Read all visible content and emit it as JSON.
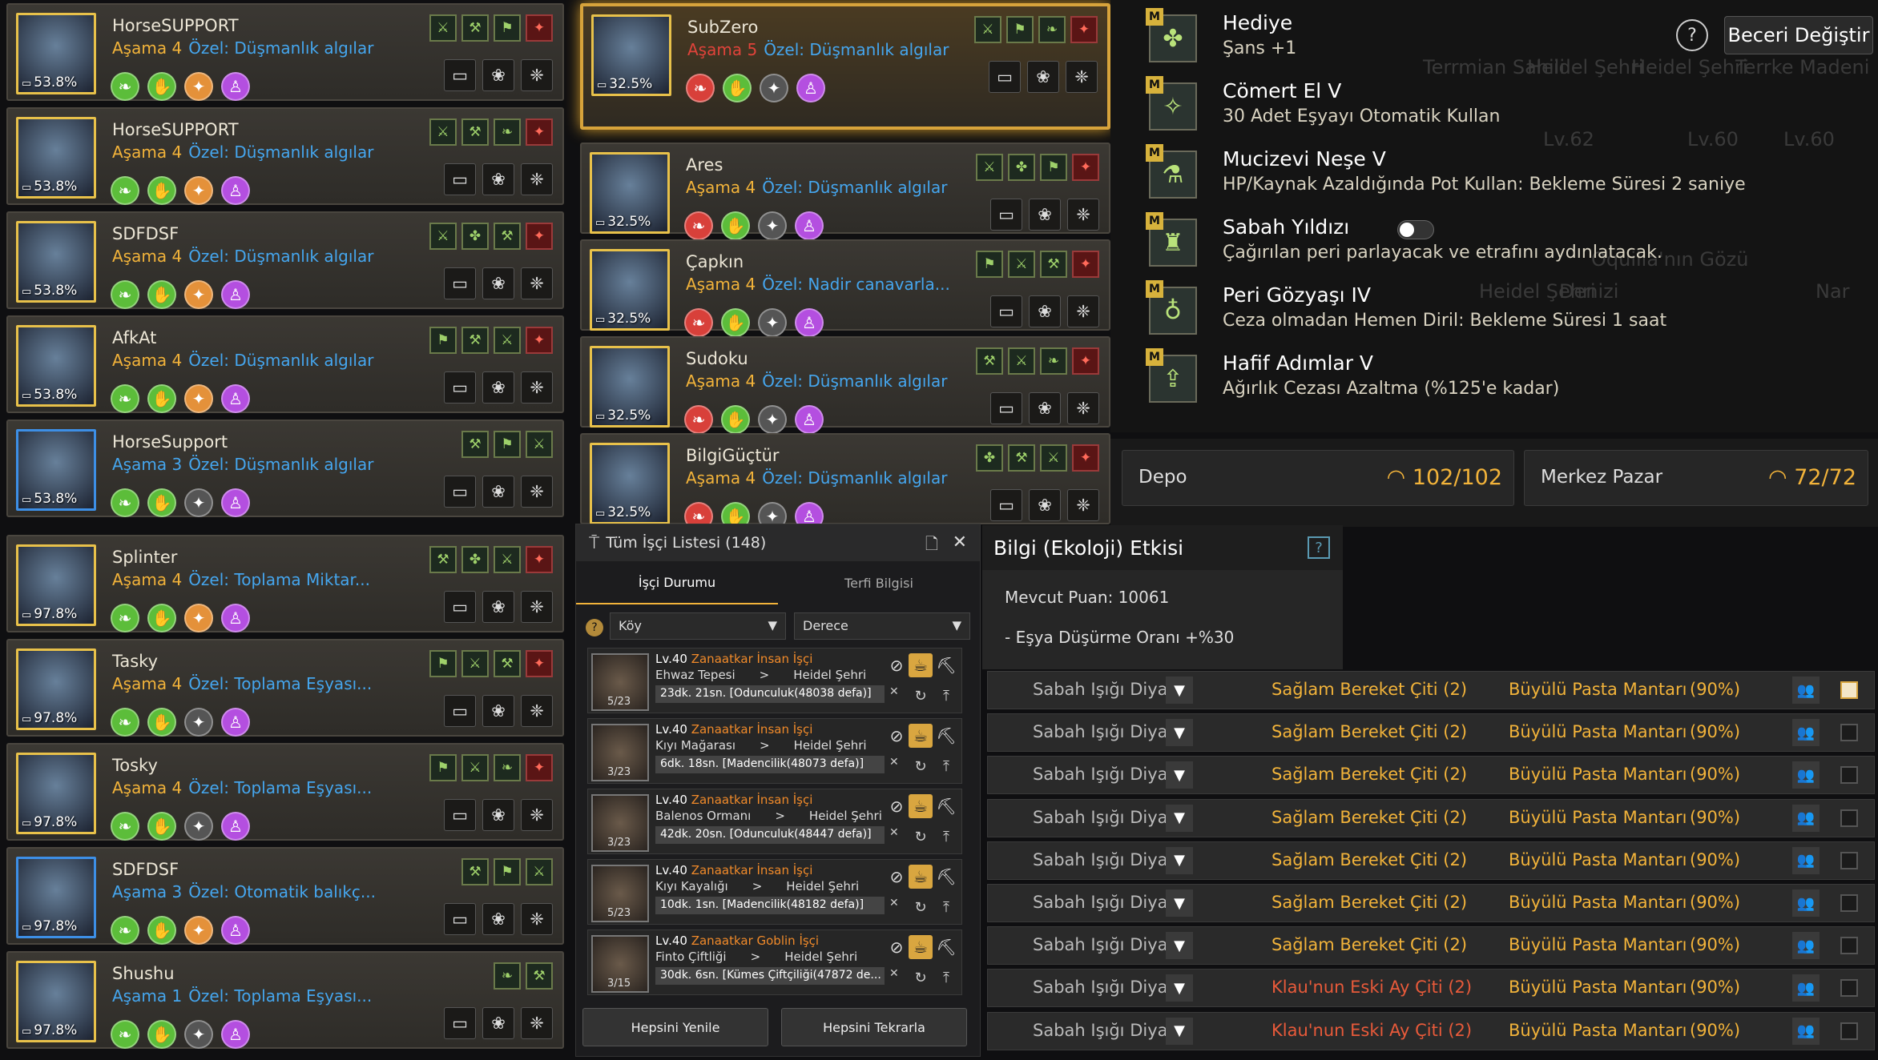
{
  "left_pets": [
    {
      "name": "HorseSUPPORT",
      "stage": "Aşama 4",
      "special": "Özel: Düşmanlık algılar",
      "pct": "53.8%",
      "traits": [
        "⚔",
        "⚒",
        "⚑",
        "✦"
      ],
      "border": "gold",
      "stageColor": "orange"
    },
    {
      "name": "HorseSUPPORT",
      "stage": "Aşama 4",
      "special": "Özel: Düşmanlık algılar",
      "pct": "53.8%",
      "traits": [
        "⚔",
        "⚒",
        "❧",
        "✦"
      ],
      "border": "gold",
      "stageColor": "orange"
    },
    {
      "name": "SDFDSF",
      "stage": "Aşama 4",
      "special": "Özel: Düşmanlık algılar",
      "pct": "53.8%",
      "traits": [
        "⚔",
        "✤",
        "⚒",
        "✦"
      ],
      "border": "gold",
      "stageColor": "orange"
    },
    {
      "name": "AfkAt",
      "stage": "Aşama 4",
      "special": "Özel: Düşmanlık algılar",
      "pct": "53.8%",
      "traits": [
        "⚑",
        "⚒",
        "⚔",
        "✦"
      ],
      "border": "gold",
      "stageColor": "orange"
    },
    {
      "name": "HorseSupport",
      "stage": "Aşama 3",
      "special": "Özel: Düşmanlık algılar",
      "pct": "53.8%",
      "traits": [
        "⚒",
        "⚑",
        "⚔"
      ],
      "border": "blue",
      "stageColor": "blue"
    },
    {
      "name": "Splinter",
      "stage": "Aşama 4",
      "special": "Özel: Toplama Miktar...",
      "pct": "97.8%",
      "traits": [
        "⚒",
        "✤",
        "⚔",
        "✦"
      ],
      "border": "gold",
      "stageColor": "orange"
    },
    {
      "name": "Tasky",
      "stage": "Aşama 4",
      "special": "Özel: Toplama Eşyası...",
      "pct": "97.8%",
      "traits": [
        "⚑",
        "⚔",
        "⚒",
        "✦"
      ],
      "border": "gold",
      "stageColor": "orange"
    },
    {
      "name": "Tosky",
      "stage": "Aşama 4",
      "special": "Özel: Toplama Eşyası...",
      "pct": "97.8%",
      "traits": [
        "⚑",
        "⚔",
        "❧",
        "✦"
      ],
      "border": "gold",
      "stageColor": "orange"
    },
    {
      "name": "SDFDSF",
      "stage": "Aşama 3",
      "special": "Özel: Otomatik balıkç...",
      "pct": "97.8%",
      "traits": [
        "⚒",
        "⚑",
        "⚔"
      ],
      "border": "blue",
      "stageColor": "blue"
    },
    {
      "name": "Shushu",
      "stage": "Aşama 1",
      "special": "Özel: Toplama Eşyası...",
      "pct": "97.8%",
      "traits": [
        "❧",
        "⚒"
      ],
      "border": "gold",
      "stageColor": "blue"
    }
  ],
  "mid_pets": [
    {
      "name": "SubZero",
      "stage": "Aşama 5",
      "special": "Özel: Düşmanlık algılar",
      "pct": "32.5%",
      "traits": [
        "⚔",
        "⚑",
        "❧",
        "✦"
      ],
      "stageColor": "red"
    },
    {
      "name": "Ares",
      "stage": "Aşama 4",
      "special": "Özel: Düşmanlık algılar",
      "pct": "32.5%",
      "traits": [
        "⚔",
        "✤",
        "⚑",
        "✦"
      ],
      "stageColor": "orange"
    },
    {
      "name": "Çapkın",
      "stage": "Aşama 4",
      "special": "Özel: Nadir canavarla...",
      "pct": "32.5%",
      "traits": [
        "⚑",
        "⚔",
        "⚒",
        "✦"
      ],
      "stageColor": "orange"
    },
    {
      "name": "Sudoku",
      "stage": "Aşama 4",
      "special": "Özel: Düşmanlık algılar",
      "pct": "32.5%",
      "traits": [
        "⚒",
        "⚔",
        "❧",
        "✦"
      ],
      "stageColor": "orange"
    },
    {
      "name": "BilgiGüçtür",
      "stage": "Aşama 4",
      "special": "Özel: Düşmanlık algılar",
      "pct": "32.5%",
      "traits": [
        "✤",
        "⚒",
        "⚔",
        "✦"
      ],
      "stageColor": "orange"
    }
  ],
  "skills": {
    "help": "?",
    "change_button": "Beceri Değiştir",
    "items": [
      {
        "title": "Hediye",
        "desc": "Şans +1",
        "icon": "✤"
      },
      {
        "title": "Cömert El V",
        "desc": "30 Adet Eşyayı Otomatik Kullan",
        "icon": "✧"
      },
      {
        "title": "Mucizevi Neşe V",
        "desc": "HP/Kaynak Azaldığında Pot Kullan: Bekleme Süresi 2 saniye",
        "icon": "⚗"
      },
      {
        "title": "Sabah Yıldızı",
        "desc": "Çağırılan peri parlayacak ve etrafını aydınlatacak.",
        "icon": "♜"
      },
      {
        "title": "Peri Gözyaşı IV",
        "desc": "Ceza olmadan Hemen Diril: Bekleme Süresi 1 saat",
        "icon": "♁"
      },
      {
        "title": "Hafif Adımlar V",
        "desc": "Ağırlık Cezası Azaltma (%125'e kadar)",
        "icon": "⇪"
      }
    ],
    "m_badge": "M"
  },
  "storage": {
    "depo_label": "Depo",
    "depo_value": "102/102",
    "pazar_label": "Merkez Pazar",
    "pazar_value": "72/72"
  },
  "workers": {
    "title": "Tüm İşçi Listesi (148)",
    "tab1": "İşçi Durumu",
    "tab2": "Terfi Bilgisi",
    "filter1": "Köy",
    "filter2": "Derece",
    "rows": [
      {
        "lvl": "Lv.40",
        "type": "Zanaatkar İnsan İşçi",
        "from": "Ehwaz Tepesi",
        "to": "Heidel Şehri",
        "task": "23dk. 21sn. [Odunculuk(48038 defa)]",
        "count": "5/23"
      },
      {
        "lvl": "Lv.40",
        "type": "Zanaatkar İnsan İşçi",
        "from": "Kıyı Mağarası",
        "to": "Heidel Şehri",
        "task": "6dk. 18sn. [Madencilik(48073 defa)]",
        "count": "3/23"
      },
      {
        "lvl": "Lv.40",
        "type": "Zanaatkar İnsan İşçi",
        "from": "Balenos Ormanı",
        "to": "Heidel Şehri",
        "task": "42dk. 20sn. [Odunculuk(48447 defa)]",
        "count": "3/23"
      },
      {
        "lvl": "Lv.40",
        "type": "Zanaatkar İnsan İşçi",
        "from": "Kıyı Kayalığı",
        "to": "Heidel Şehri",
        "task": "10dk. 1sn. [Madencilik(48182 defa)]",
        "count": "5/23"
      },
      {
        "lvl": "Lv.40",
        "type": "Zanaatkar Goblin İşçi",
        "from": "Finto Çiftliği",
        "to": "Heidel Şehri",
        "task": "30dk. 6sn. [Kümes Çiftçiliği(47872 de...",
        "count": "3/15"
      }
    ],
    "refresh_all": "Hepsini Yenile",
    "repeat_all": "Hepsini Tekrarla"
  },
  "eco": {
    "title": "Bilgi (Ekoloji) Etkisi",
    "help": "?",
    "points": "Mevcut Puan: 10061",
    "drop": "- Eşya Düşürme Oranı +%30"
  },
  "crops": [
    {
      "place": "Sabah Işığı Diyarı",
      "fence": "Sağlam Bereket Çiti (2)",
      "mush": "Büyülü Pasta Mantarı",
      "pct": "(90%)",
      "checked": true
    },
    {
      "place": "Sabah Işığı Diyarı",
      "fence": "Sağlam Bereket Çiti (2)",
      "mush": "Büyülü Pasta Mantarı",
      "pct": "(90%)",
      "checked": false
    },
    {
      "place": "Sabah Işığı Diyarı",
      "fence": "Sağlam Bereket Çiti (2)",
      "mush": "Büyülü Pasta Mantarı",
      "pct": "(90%)",
      "checked": false
    },
    {
      "place": "Sabah Işığı Diyarı",
      "fence": "Sağlam Bereket Çiti (2)",
      "mush": "Büyülü Pasta Mantarı",
      "pct": "(90%)",
      "checked": false
    },
    {
      "place": "Sabah Işığı Diyarı",
      "fence": "Sağlam Bereket Çiti (2)",
      "mush": "Büyülü Pasta Mantarı",
      "pct": "(90%)",
      "checked": false
    },
    {
      "place": "Sabah Işığı Diyarı",
      "fence": "Sağlam Bereket Çiti (2)",
      "mush": "Büyülü Pasta Mantarı",
      "pct": "(90%)",
      "checked": false
    },
    {
      "place": "Sabah Işığı Diyarı",
      "fence": "Sağlam Bereket Çiti (2)",
      "mush": "Büyülü Pasta Mantarı",
      "pct": "(90%)",
      "checked": false
    },
    {
      "place": "Sabah Işığı Diyarı",
      "fence": "Klau'nun Eski Ay Çiti (2)",
      "mush": "Büyülü Pasta Mantarı",
      "pct": "(90%)",
      "checked": false
    },
    {
      "place": "Sabah Işığı Diyarı",
      "fence": "Klau'nun Eski Ay Çiti (2)",
      "mush": "Büyülü Pasta Mantarı",
      "pct": "(90%)",
      "checked": false
    }
  ],
  "bg_map_labels": [
    "Terrmian Sahili",
    "Heidel Şehri",
    "Heidel Şehri",
    "Terrke Madeni",
    "Lv.62",
    "Lv.60",
    "Lv.60",
    "Oquilla'nın Gözü",
    "Heidel Şehri",
    "Denizi",
    "Nar"
  ]
}
